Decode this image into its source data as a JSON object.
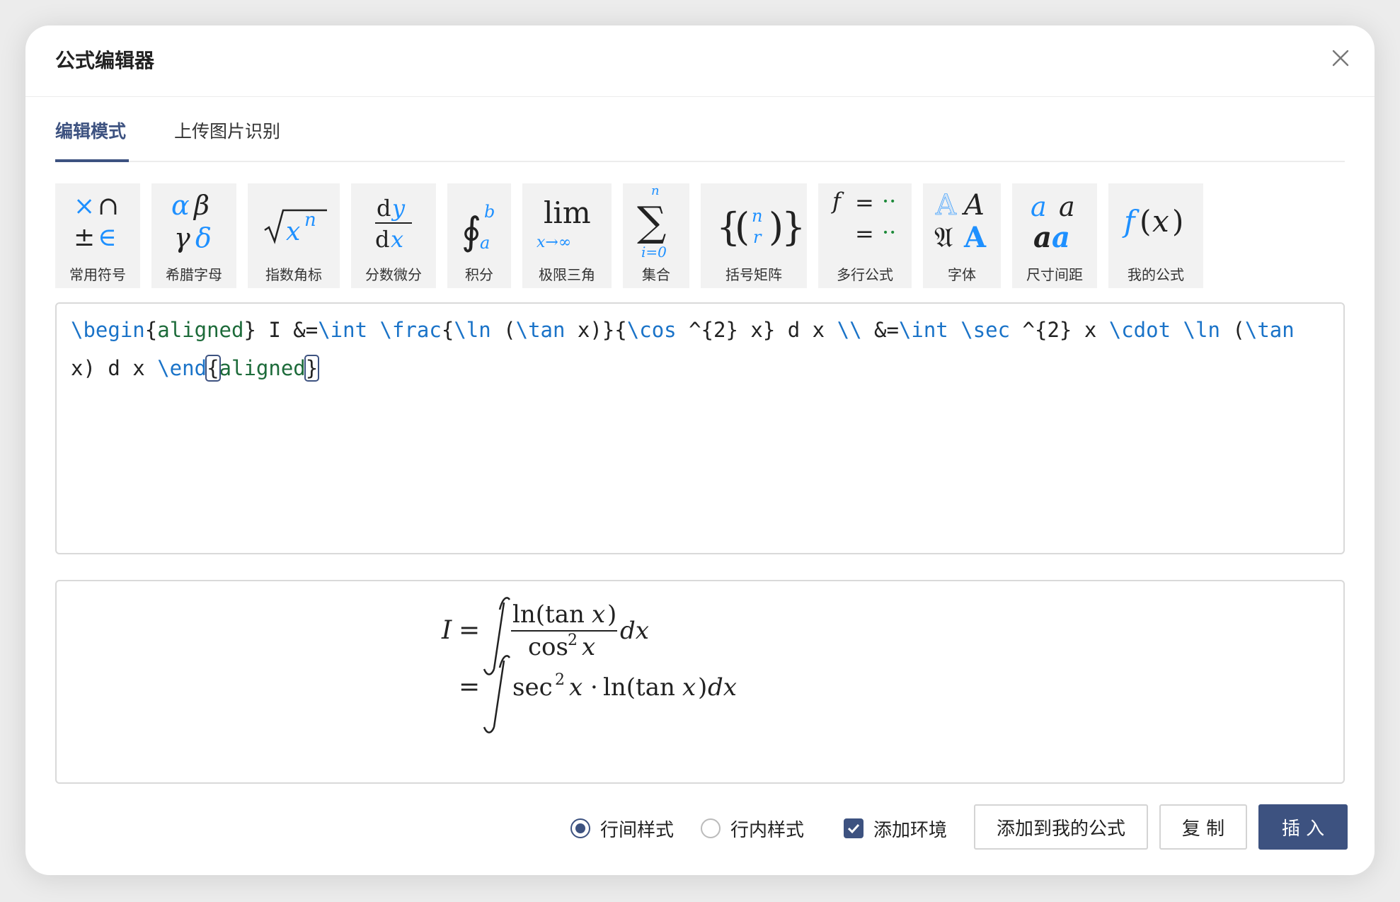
{
  "dialog": {
    "title": "公式编辑器",
    "close_icon": "close-icon"
  },
  "tabs": [
    {
      "label": "编辑模式",
      "active": true
    },
    {
      "label": "上传图片识别",
      "active": false
    }
  ],
  "toolbar": [
    {
      "label": "常用符号",
      "icon": "common-symbols-icon"
    },
    {
      "label": "希腊字母",
      "icon": "greek-letters-icon"
    },
    {
      "label": "指数角标",
      "icon": "exponent-icon"
    },
    {
      "label": "分数微分",
      "icon": "fraction-derivative-icon"
    },
    {
      "label": "积分",
      "icon": "integral-icon"
    },
    {
      "label": "极限三角",
      "icon": "limit-trig-icon"
    },
    {
      "label": "集合",
      "icon": "sum-set-icon"
    },
    {
      "label": "括号矩阵",
      "icon": "bracket-matrix-icon"
    },
    {
      "label": "多行公式",
      "icon": "multiline-icon"
    },
    {
      "label": "字体",
      "icon": "font-icon"
    },
    {
      "label": "尺寸间距",
      "icon": "size-spacing-icon"
    },
    {
      "label": "我的公式",
      "icon": "my-formula-icon"
    }
  ],
  "editor": {
    "latex": "\\begin{aligned} I &=\\int \\frac{\\ln (\\tan x)}{\\cos ^{2} x} d x \\\\ &=\\int \\sec ^{2} x \\cdot \\ln (\\tan x) d x \\end{aligned}"
  },
  "footer": {
    "display_style_label": "行间样式",
    "inline_style_label": "行内样式",
    "add_env_label": "添加环境",
    "display_style_selected": true,
    "add_env_checked": true,
    "add_to_mine_label": "添加到我的公式",
    "copy_label": "复 制",
    "insert_label": "插 入"
  },
  "colors": {
    "accent": "#3d5280",
    "command": "#1a73c8",
    "argument": "#1d6b3a",
    "icon_blue": "#1e90ff"
  }
}
